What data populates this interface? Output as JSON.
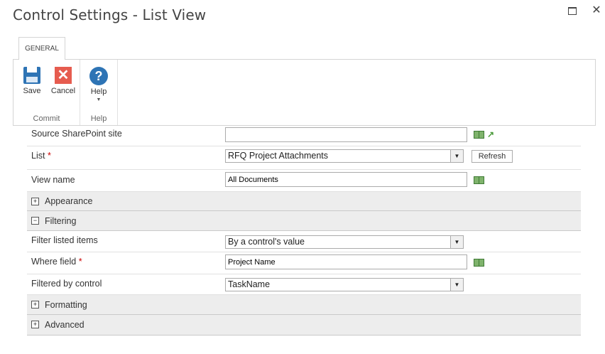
{
  "window": {
    "title": "Control Settings - List View",
    "maximize_icon": "maximize-icon",
    "close_glyph": "✕"
  },
  "ribbon": {
    "tab_label": "GENERAL",
    "groups": [
      {
        "label": "Commit",
        "buttons": [
          {
            "label": "Save",
            "icon": "save-icon"
          },
          {
            "label": "Cancel",
            "icon": "cancel-icon"
          }
        ]
      },
      {
        "label": "Help",
        "buttons": [
          {
            "label": "Help",
            "icon": "help-icon"
          }
        ]
      }
    ],
    "cancel_glyph": "✕",
    "help_glyph": "?",
    "dropdown_glyph": "▼"
  },
  "form": {
    "source_site": {
      "label": "Source SharePoint site",
      "value": ""
    },
    "list": {
      "label": "List",
      "required_mark": "*",
      "value": "RFQ Project Attachments",
      "refresh_label": "Refresh"
    },
    "view_name": {
      "label": "View name",
      "value": "All Documents"
    },
    "sections": {
      "appearance": {
        "label": "Appearance",
        "toggle": "+"
      },
      "filtering": {
        "label": "Filtering",
        "toggle": "−"
      },
      "formatting": {
        "label": "Formatting",
        "toggle": "+"
      },
      "advanced": {
        "label": "Advanced",
        "toggle": "+"
      }
    },
    "filter_listed_items": {
      "label": "Filter listed items",
      "value": "By a control's value"
    },
    "where_field": {
      "label": "Where field",
      "required_mark": "*",
      "value": "Project Name"
    },
    "filtered_by_control": {
      "label": "Filtered by control",
      "value": "TaskName"
    },
    "select_arrow_glyph": "▼",
    "link_arrow_glyph": "↗"
  },
  "colors": {
    "accent_blue": "#2e74b5",
    "cancel_red": "#e65c4f",
    "required_red": "#cc0000",
    "section_bg": "#ededed"
  }
}
